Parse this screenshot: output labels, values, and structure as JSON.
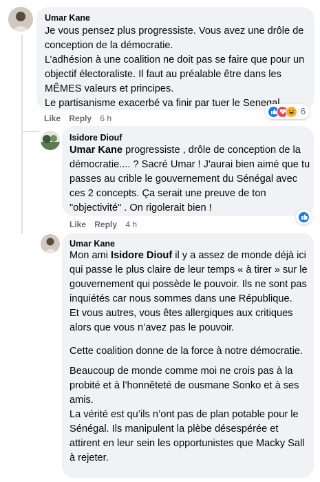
{
  "comments": [
    {
      "author": "Umar Kane",
      "lines": [
        "Je vous pensez plus progressiste. Vous avez une drôle de conception de la démocratie.",
        "L’adhésion à une coalition ne doit pas se faire que pour un objectif électoraliste. Il faut au préalable être dans les MÊMES valeurs et principes.",
        "Le partisanisme exacerbé va finir par tuer le Senegal.."
      ],
      "actions": {
        "like": "Like",
        "reply": "Reply",
        "time": "6 h"
      },
      "reactions": {
        "icons": [
          "like-icon",
          "love-icon",
          "haha-icon"
        ],
        "count": "6"
      }
    },
    {
      "author": "Isidore Diouf",
      "mention": "Umar Kane",
      "text": " progressiste , drôle de conception de la démocratie.... ? Sacré Umar ! J'aurai bien aimé que tu passes au crible le gouvernement du Sénégal avec ces 2 concepts. Ça serait une preuve de ton \"objectivité\" . On rigolerait bien !",
      "actions": {
        "like": "Like",
        "reply": "Reply",
        "time": "4 h"
      },
      "reactions": {
        "icons": [
          "like-icon"
        ],
        "count": ""
      }
    },
    {
      "author": "Umar Kane",
      "para1_prefix": "Mon ami ",
      "mention": "Isidore Diouf",
      "para1_rest": " il y a assez de monde déjà ici qui passe le plus claire de leur temps « à tirer » sur le gouvernement qui possède le pouvoir. Ils ne sont pas inquiétés car nous sommes dans une République.",
      "para2": "Et vous autres, vous êtes allergiques aux critiques alors que vous n’avez pas le pouvoir.",
      "para3": "Cette coalition donne de la force à notre démocratie.",
      "para4": "Beaucoup de monde comme moi ne crois pas à la probité et à l’honnêteté de ousmane Sonko et à ses amis.",
      "para5": "La vérité est qu’ils n’ont pas de plan potable pour le Sénégal. Ils manipulent la plèbe désespérée et attirent en leur sein les opportunistes que Macky Sall à rejeter."
    }
  ],
  "colors": {
    "bubble": "#f0f2f5",
    "like_blue": "#1877f2",
    "love_red": "#f33e58",
    "haha_yellow": "#f7b125"
  }
}
